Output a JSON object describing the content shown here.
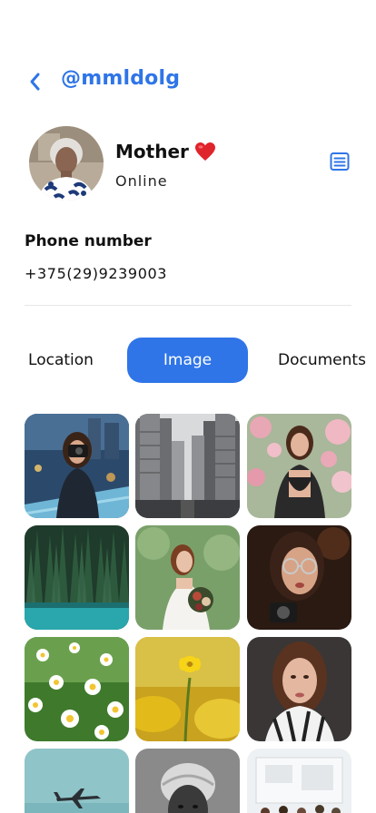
{
  "header": {
    "username": "@mmldolg"
  },
  "profile": {
    "name": "Mother",
    "status": "Online"
  },
  "contact": {
    "phone_label": "Phone number",
    "phone_value": "+375(29)9239003"
  },
  "tabs": [
    {
      "label": "Location",
      "active": false
    },
    {
      "label": "Image",
      "active": true
    },
    {
      "label": "Documents",
      "active": false
    }
  ],
  "gallery": {
    "images": [
      "photographer-city",
      "skyscrapers",
      "woman-flowers",
      "forest-lake",
      "bride-bouquet",
      "woman-glasses",
      "daisies",
      "yellow-flowers",
      "woman-portrait",
      "airplane-sky",
      "man-headscarf",
      "office-meeting"
    ]
  },
  "colors": {
    "accent": "#2f75e8",
    "heart": "#e0242b"
  }
}
